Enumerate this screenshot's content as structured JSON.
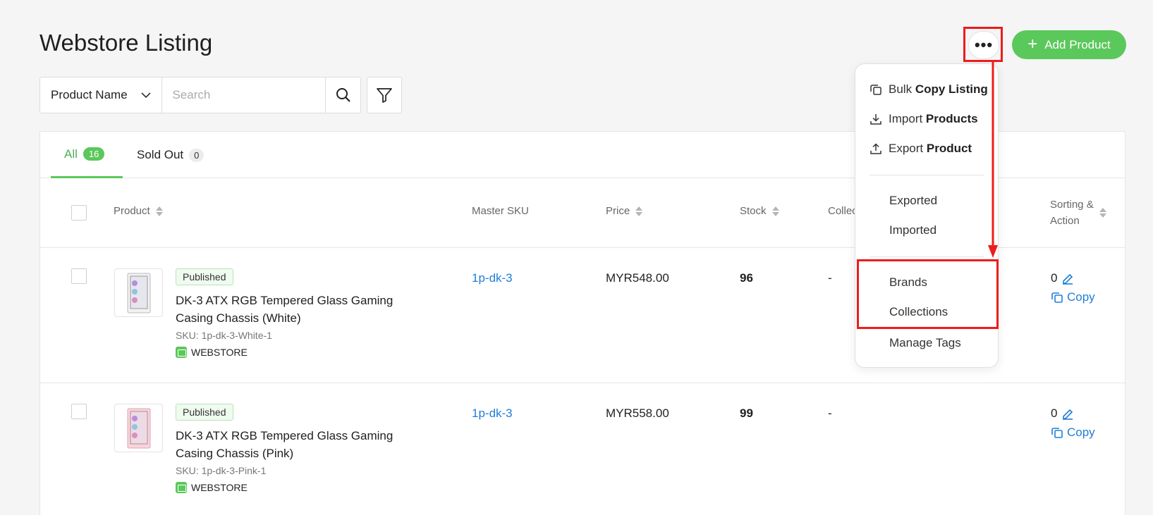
{
  "page": {
    "title": "Webstore Listing"
  },
  "header": {
    "more_label": "•••",
    "add_product_label": "Add Product",
    "add_icon": "+"
  },
  "search": {
    "field_select": "Product Name",
    "placeholder": "Search"
  },
  "tabs": [
    {
      "label": "All",
      "count": "16"
    },
    {
      "label": "Sold Out",
      "count": "0"
    }
  ],
  "table": {
    "columns": [
      "Product",
      "Master SKU",
      "Price",
      "Stock",
      "Collec",
      "Sorting &",
      "Action"
    ],
    "rows": [
      {
        "status": "Published",
        "name": "DK-3 ATX RGB Tempered Glass Gaming Casing Chassis (White)",
        "sku": "SKU: 1p-dk-3-White-1",
        "channel": "WEBSTORE",
        "master_sku": "1p-dk-3",
        "price": "MYR548.00",
        "stock": "96",
        "collection": "-",
        "sort": "0",
        "copy": "Copy"
      },
      {
        "status": "Published",
        "name": "DK-3 ATX RGB Tempered Glass Gaming Casing Chassis (Pink)",
        "sku": "SKU: 1p-dk-3-Pink-1",
        "channel": "WEBSTORE",
        "master_sku": "1p-dk-3",
        "price": "MYR558.00",
        "stock": "99",
        "collection": "-",
        "sort": "0",
        "copy": "Copy"
      }
    ]
  },
  "dropdown": {
    "items": [
      {
        "prefix": "Bulk",
        "bold": "Copy Listing",
        "icon": "copy-icon"
      },
      {
        "prefix": "Import",
        "bold": "Products",
        "icon": "download-icon"
      },
      {
        "prefix": "Export",
        "bold": "Product",
        "icon": "upload-icon"
      }
    ],
    "exported": "Exported",
    "imported": "Imported",
    "brands": "Brands",
    "collections": "Collections",
    "manage_tags": "Manage Tags"
  },
  "colors": {
    "accent": "#5bc85b",
    "link": "#1f7ed6",
    "annotation": "#ee1c1c"
  }
}
